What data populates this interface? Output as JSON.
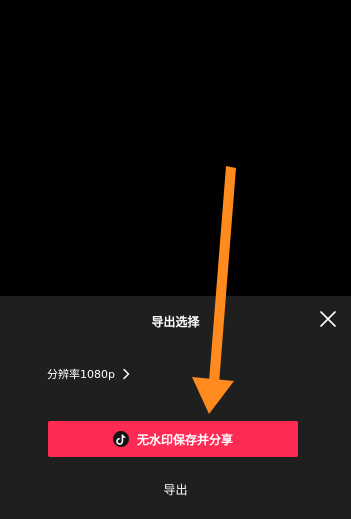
{
  "sheet": {
    "title": "导出选择",
    "resolution_label": "分辨率",
    "resolution_value": "1080p",
    "primary_button_label": "无水印保存并分享",
    "secondary_button_label": "导出"
  },
  "icons": {
    "close": "close-icon",
    "chevron": "chevron-right-icon",
    "brand": "tiktok-logo-icon",
    "annotation": "orange-arrow-icon"
  },
  "colors": {
    "background": "#000000",
    "sheet_background": "#1f1f1f",
    "primary_button": "#fe2c55",
    "arrow": "#ff8a1e"
  }
}
